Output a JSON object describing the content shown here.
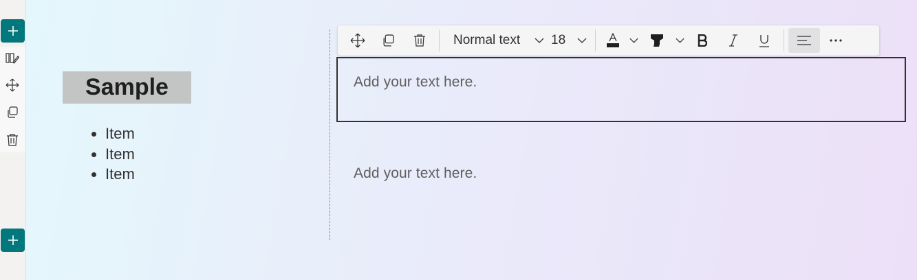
{
  "rail": {
    "add_top_label": "Add section",
    "add_bottom_label": "Add section"
  },
  "left_column": {
    "heading": "Sample",
    "bullets": [
      "Item",
      "Item",
      "Item"
    ]
  },
  "toolbar": {
    "text_style": "Normal text",
    "font_size": "18"
  },
  "right_column": {
    "textbox1_placeholder": "Add your text here.",
    "textbox2_placeholder": "Add your text here."
  },
  "colors": {
    "accent": "#03787c",
    "heading_bg": "#c3c4c4",
    "toolbar_bg": "#f5f5f6"
  }
}
